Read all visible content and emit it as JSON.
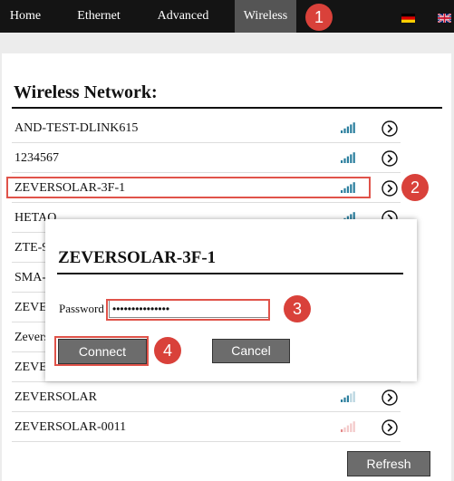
{
  "nav": {
    "items": [
      {
        "label": "Home"
      },
      {
        "label": "Ethernet"
      },
      {
        "label": "Advanced"
      },
      {
        "label": "Wireless",
        "active": true
      }
    ],
    "languages": [
      "german-flag-icon",
      "uk-flag-icon"
    ]
  },
  "callouts": [
    "1",
    "2",
    "3",
    "4"
  ],
  "wireless": {
    "title": "Wireless Network:",
    "networks": [
      {
        "ssid": "AND-TEST-DLINK615",
        "signal": "strong"
      },
      {
        "ssid": "1234567",
        "signal": "strong"
      },
      {
        "ssid": "ZEVERSOLAR-3F-1",
        "signal": "strong"
      },
      {
        "ssid": "HETAO",
        "signal": "strong"
      },
      {
        "ssid": "ZTE-9",
        "signal": "strong"
      },
      {
        "ssid": "SMA-",
        "signal": "strong"
      },
      {
        "ssid": "ZEVE",
        "signal": "strong"
      },
      {
        "ssid": "Zevers",
        "signal": "strong"
      },
      {
        "ssid": "ZEVE",
        "signal": "strong"
      },
      {
        "ssid": "ZEVERSOLAR",
        "signal": "medium"
      },
      {
        "ssid": "ZEVERSOLAR-0011",
        "signal": "weak"
      }
    ],
    "refresh_label": "Refresh"
  },
  "popup": {
    "title": "ZEVERSOLAR-3F-1",
    "password_label": "Password",
    "password_value": "•••••••••••••••",
    "connect_label": "Connect",
    "cancel_label": "Cancel"
  },
  "colors": {
    "signal_strong": "#2c7f9e",
    "signal_weak": "#e58a8a",
    "highlight": "#e0534a",
    "callout": "#d9413a"
  }
}
